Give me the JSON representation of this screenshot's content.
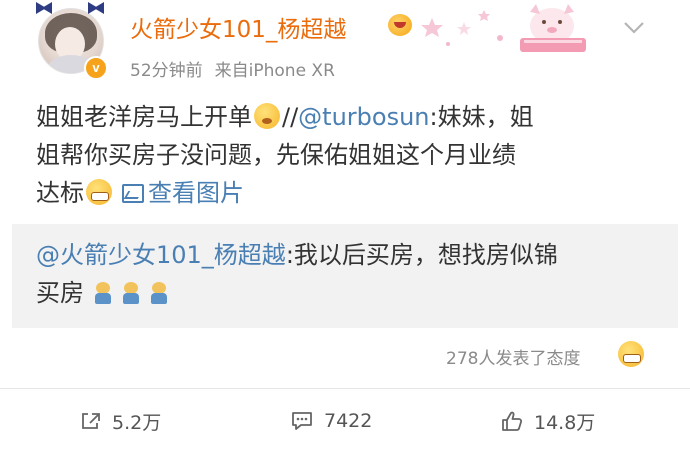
{
  "post": {
    "author": {
      "name": "火箭少女101_杨超越",
      "verified_mark": "v"
    },
    "meta": {
      "time": "52分钟前",
      "source": "来自iPhone XR"
    },
    "content": {
      "line1_text": "姐姐老洋房马上开单",
      "line1_separator": "//",
      "line1_mention": "@turbosun",
      "line1_after": ":妹妹，姐",
      "line2": "姐帮你买房子没问题，先保佑姐姐这个月业绩",
      "line3_text": "达标",
      "view_image_label": "查看图片"
    },
    "quoted": {
      "mention": "@火箭少女101_杨超越",
      "line1_after": ":我以后买房，想找房似锦",
      "line2_text": "买房"
    },
    "reactions": {
      "text": "278人发表了态度"
    },
    "actions": {
      "repost_count": "5.2万",
      "comment_count": "7422",
      "like_count": "14.8万"
    }
  },
  "icons": {
    "avatar": "avatar-image",
    "verified": "verified-badge-icon",
    "member": "member-crown-icon",
    "decoration": "card-decoration-icon",
    "menu": "chevron-down-icon",
    "image": "image-icon",
    "repost": "repost-icon",
    "comment": "comment-icon",
    "like": "like-icon"
  },
  "colors": {
    "username": "#ea6c0d",
    "link": "#4a7fb3",
    "meta": "#8a8a8a",
    "quoted_background": "#f2f2f2",
    "verified": "#f7a21b"
  }
}
